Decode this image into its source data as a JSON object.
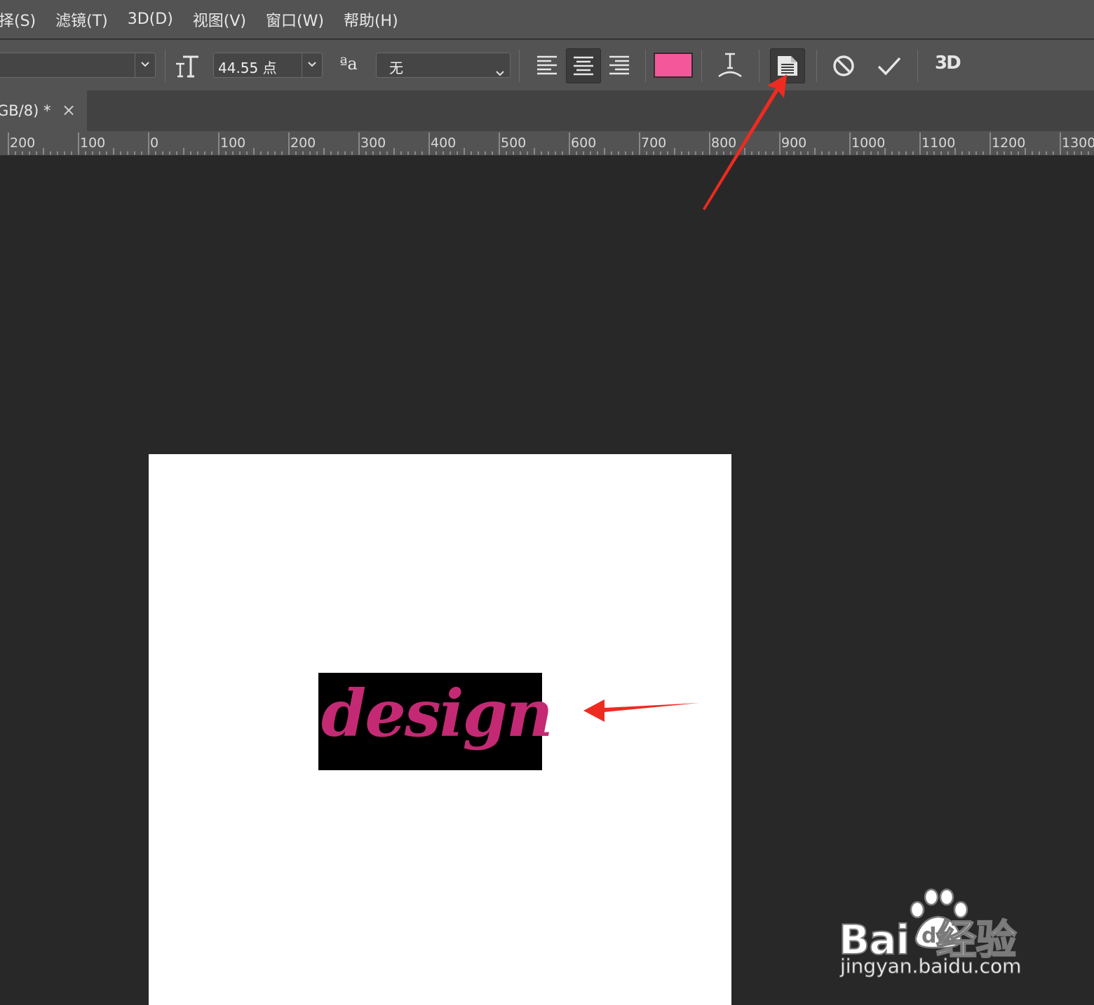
{
  "menubar": {
    "items": [
      {
        "label": "择(S)"
      },
      {
        "label": "滤镜(T)"
      },
      {
        "label": "3D(D)"
      },
      {
        "label": "视图(V)"
      },
      {
        "label": "窗口(W)"
      },
      {
        "label": "帮助(H)"
      }
    ]
  },
  "options": {
    "font_style_value": "",
    "font_size_value": "44.55 点",
    "antialias_label": "ªa",
    "antialias_value": "无",
    "text_color": "#f5589a",
    "threed_label": "3D"
  },
  "tab": {
    "title": "GB/8) *",
    "close_label": "×"
  },
  "ruler": {
    "labels": [
      "200",
      "100",
      "0",
      "100",
      "200",
      "300",
      "400",
      "500",
      "600",
      "700",
      "800",
      "900",
      "1000",
      "1100",
      "1200",
      "1300"
    ]
  },
  "canvas": {
    "text_layer": "design",
    "text_color": "#c42a73"
  },
  "watermark": {
    "main": "Bai  经验",
    "paw_text": "du",
    "sub": "jingyan.baidu.com"
  },
  "annotations": {
    "arrow_color": "#ee2b20"
  }
}
